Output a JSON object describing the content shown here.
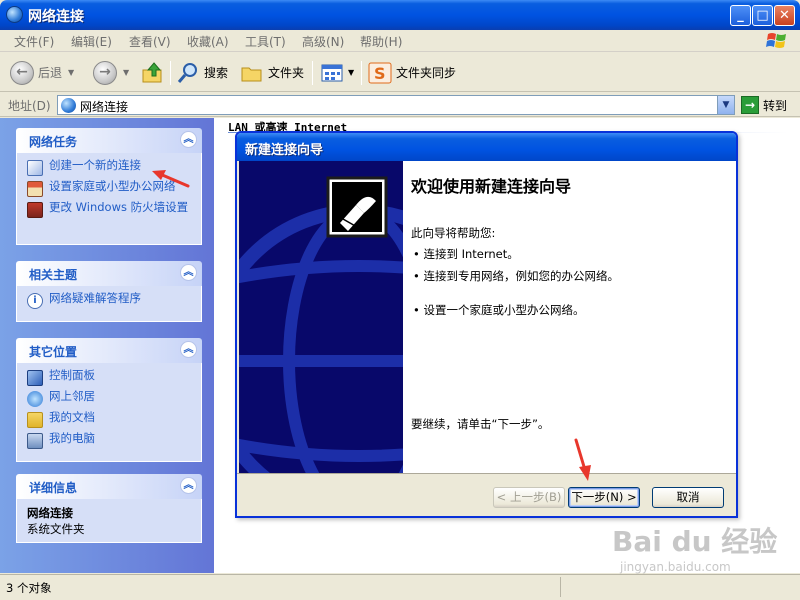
{
  "window": {
    "title": "网络连接"
  },
  "menu": {
    "items": [
      "文件(F)",
      "编辑(E)",
      "查看(V)",
      "收藏(A)",
      "工具(T)",
      "高级(N)",
      "帮助(H)"
    ]
  },
  "toolbar": {
    "back": "后退",
    "search": "搜索",
    "folders": "文件夹",
    "sync": "文件夹同步"
  },
  "address": {
    "label": "地址(D)",
    "value": "网络连接",
    "go": "转到"
  },
  "leftpane": {
    "network_tasks": {
      "title": "网络任务",
      "items": [
        "创建一个新的连接",
        "设置家庭或小型办公网络",
        "更改 Windows 防火墙设置"
      ]
    },
    "related": {
      "title": "相关主题",
      "items": [
        "网络疑难解答程序"
      ]
    },
    "other_places": {
      "title": "其它位置",
      "items": [
        "控制面板",
        "网上邻居",
        "我的文档",
        "我的电脑"
      ]
    },
    "details": {
      "title": "详细信息",
      "name": "网络连接",
      "type": "系统文件夹"
    }
  },
  "content": {
    "group_header": "LAN 或高速 Internet"
  },
  "wizard": {
    "title": "新建连接向导",
    "heading": "欢迎使用新建连接向导",
    "intro": "此向导将帮助您:",
    "bullets": [
      "连接到 Internet。",
      "连接到专用网络，例如您的办公网络。",
      "设置一个家庭或小型办公网络。"
    ],
    "continue": "要继续，请单击“下一步”。",
    "back": "< 上一步(B)",
    "next": "下一步(N) >",
    "cancel": "取消"
  },
  "status": {
    "text": "3 个对象"
  },
  "watermark": {
    "logo": "Bai du 经验",
    "url": "jingyan.baidu.com"
  },
  "colors": {
    "xp_blue": "#0053e1",
    "task_link": "#215dc6",
    "wizard_side": "#08086a",
    "annotation": "#e8372c"
  }
}
